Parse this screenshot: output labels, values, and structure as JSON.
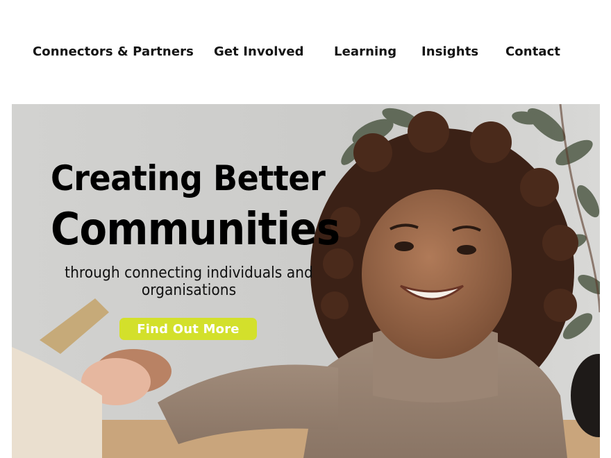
{
  "nav": {
    "items": [
      {
        "label": "Connectors & Partners"
      },
      {
        "label": "Get Involved"
      },
      {
        "label": "Learning"
      },
      {
        "label": "Insights"
      },
      {
        "label": "Contact"
      }
    ]
  },
  "hero": {
    "headline_line1": "Creating Better",
    "headline_line2": "Communities",
    "subheading": "through connecting individuals and organisations",
    "cta_label": "Find Out More",
    "image_description": "handshake-photo",
    "colors": {
      "cta_background": "#d3e02b",
      "cta_text": "#ffffff",
      "headline": "#000000"
    }
  }
}
